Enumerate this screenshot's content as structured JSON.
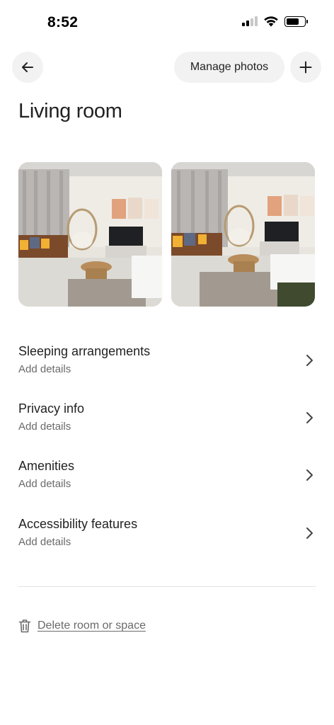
{
  "status_bar": {
    "time": "8:52",
    "battery_level": 0.7
  },
  "header": {
    "back_icon": "arrow-left-icon",
    "manage_photos_label": "Manage photos",
    "add_icon": "plus-icon"
  },
  "page": {
    "title": "Living room"
  },
  "photos": [
    {
      "description_icon": "room-photo"
    },
    {
      "description_icon": "room-photo"
    }
  ],
  "sections": [
    {
      "title": "Sleeping arrangements",
      "subtitle": "Add details"
    },
    {
      "title": "Privacy info",
      "subtitle": "Add details"
    },
    {
      "title": "Amenities",
      "subtitle": "Add details"
    },
    {
      "title": "Accessibility features",
      "subtitle": "Add details"
    }
  ],
  "footer": {
    "delete_label": "Delete room or space",
    "delete_icon": "trash-icon"
  },
  "colors": {
    "text_primary": "#222222",
    "text_secondary": "#6a6a6a",
    "button_bg": "#f2f2f2"
  }
}
